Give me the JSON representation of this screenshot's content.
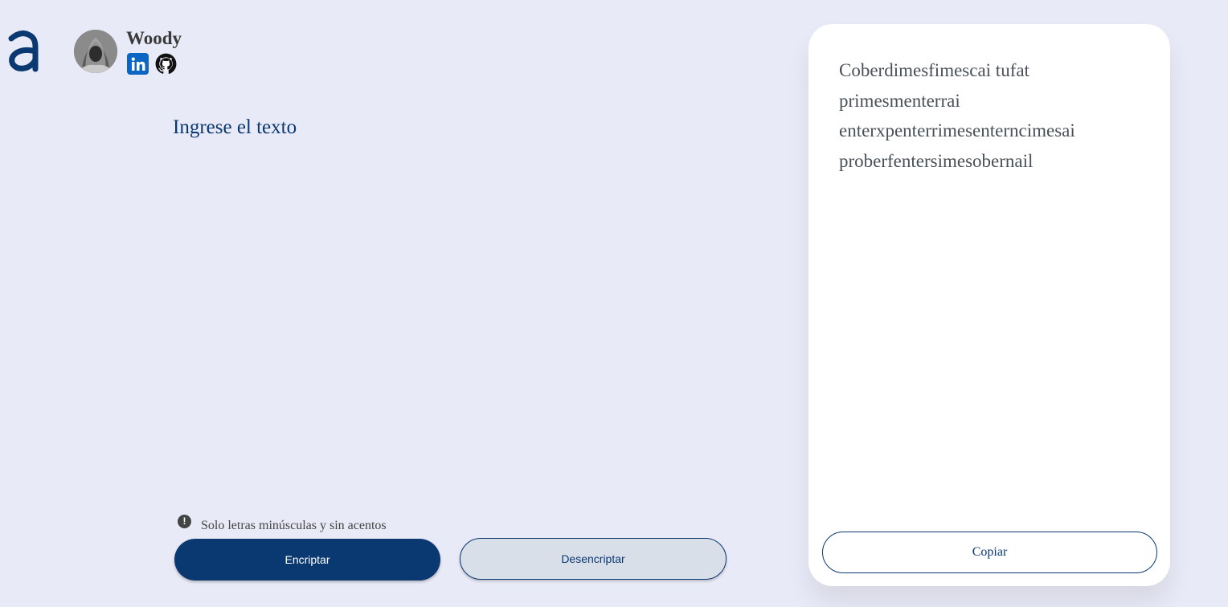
{
  "header": {
    "logo": "alura-logo-icon",
    "username": "Woody",
    "avatar": "avatar",
    "social": [
      "linkedin-icon",
      "github-icon"
    ]
  },
  "input": {
    "placeholder": "Ingrese el texto",
    "value": ""
  },
  "hint": {
    "icon": "exclamation-circle-icon",
    "text": "Solo letras minúsculas y sin acentos"
  },
  "buttons": {
    "encrypt_label": "Encriptar",
    "decrypt_label": "Desencriptar"
  },
  "output": {
    "text": "Coberdimesfimescai tufat primesmenterrai enterxpenterrimesenterncimesai proberfentersimesobernail",
    "copy_label": "Copiar"
  },
  "colors": {
    "background": "#e9eaf7",
    "primary": "#0a3871",
    "secondary_button": "#d8dfe8",
    "card": "#ffffff",
    "output_text": "#495057"
  }
}
